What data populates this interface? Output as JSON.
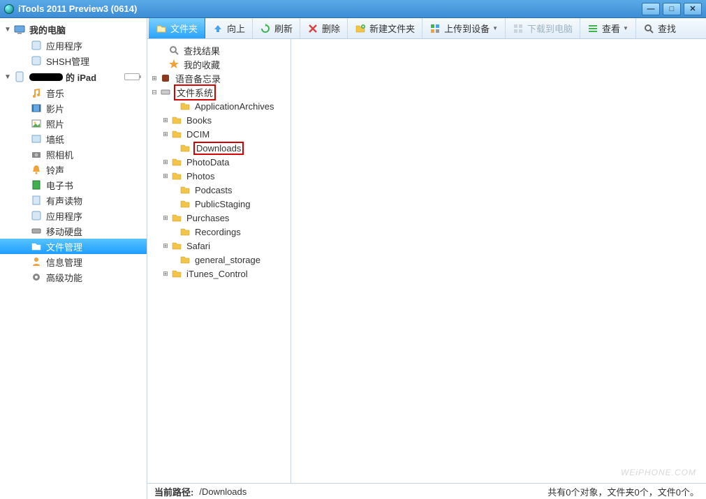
{
  "title": "iTools 2011 Preview3 (0614)",
  "sidebar": {
    "computer": {
      "label": "我的电脑",
      "items": [
        {
          "label": "应用程序"
        },
        {
          "label": "SHSH管理"
        }
      ]
    },
    "device": {
      "label_suffix": "的 iPad",
      "items": [
        {
          "label": "音乐"
        },
        {
          "label": "影片"
        },
        {
          "label": "照片"
        },
        {
          "label": "墙纸"
        },
        {
          "label": "照相机"
        },
        {
          "label": "铃声"
        },
        {
          "label": "电子书"
        },
        {
          "label": "有声读物"
        },
        {
          "label": "应用程序"
        },
        {
          "label": "移动硬盘"
        },
        {
          "label": "文件管理"
        },
        {
          "label": "信息管理"
        },
        {
          "label": "高级功能"
        }
      ]
    }
  },
  "toolbar": {
    "folder": "文件夹",
    "up": "向上",
    "refresh": "刷新",
    "delete": "删除",
    "newfolder": "新建文件夹",
    "upload": "上传到设备",
    "download": "下载到电脑",
    "view": "查看",
    "search": "查找"
  },
  "tree": {
    "root": [
      {
        "label": "查找结果",
        "icon": "search"
      },
      {
        "label": "我的收藏",
        "icon": "star"
      },
      {
        "label": "语音备忘录",
        "icon": "voice",
        "exp": "plus"
      }
    ],
    "fs": {
      "label": "文件系统",
      "highlight": true,
      "children": [
        {
          "label": "ApplicationArchives"
        },
        {
          "label": "Books",
          "exp": "plus"
        },
        {
          "label": "DCIM",
          "exp": "plus"
        },
        {
          "label": "Downloads",
          "highlight": true
        },
        {
          "label": "PhotoData",
          "exp": "plus"
        },
        {
          "label": "Photos",
          "exp": "plus"
        },
        {
          "label": "Podcasts"
        },
        {
          "label": "PublicStaging"
        },
        {
          "label": "Purchases",
          "exp": "plus"
        },
        {
          "label": "Recordings"
        },
        {
          "label": "Safari",
          "exp": "plus"
        },
        {
          "label": "general_storage"
        },
        {
          "label": "iTunes_Control",
          "exp": "plus"
        }
      ]
    }
  },
  "status": {
    "label": "当前路径:",
    "path": "/Downloads",
    "summary": "共有0个对象，文件夹0个，文件0个。"
  },
  "watermark": "WEiPHONE.COM"
}
